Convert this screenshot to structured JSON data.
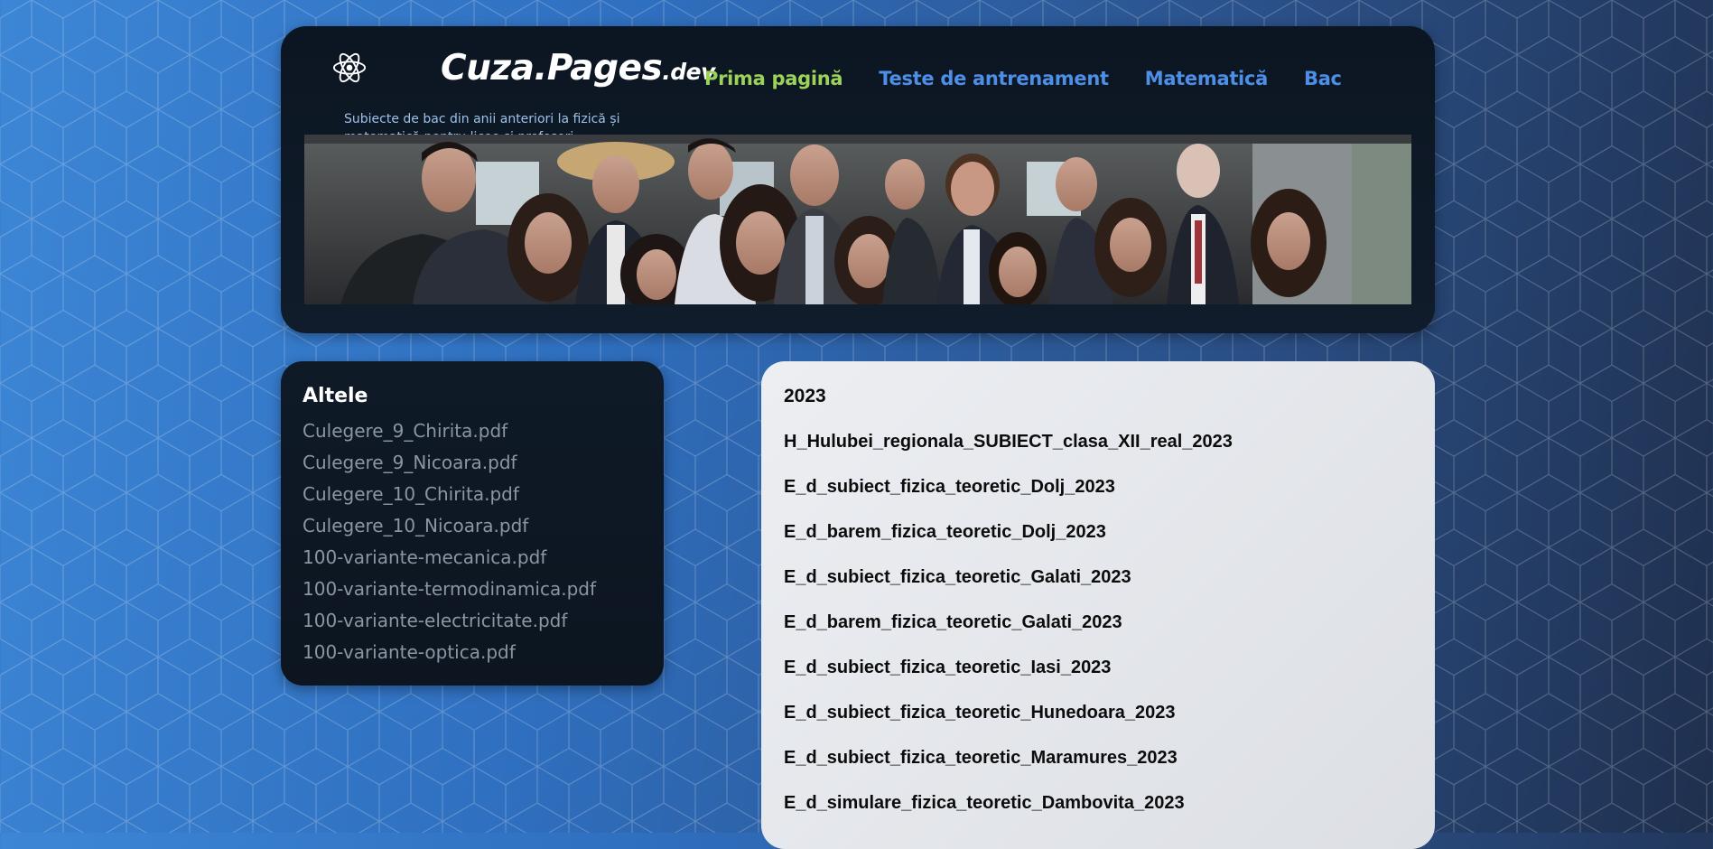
{
  "brand": {
    "name": "Cuza.Pages",
    "suffix": ".dev",
    "tagline": "Subiecte de bac din anii anteriori la fizică și matematică pentru licee și profesori."
  },
  "nav": [
    {
      "label": "Prima pagină",
      "active": true
    },
    {
      "label": "Teste de antrenament",
      "active": false
    },
    {
      "label": "Matematică",
      "active": false
    },
    {
      "label": "Bac",
      "active": false
    }
  ],
  "sidebar": {
    "title": "Altele",
    "items": [
      "Culegere_9_Chirita.pdf",
      "Culegere_9_Nicoara.pdf",
      "Culegere_10_Chirita.pdf",
      "Culegere_10_Nicoara.pdf",
      "100-variante-mecanica.pdf",
      "100-variante-termodinamica.pdf",
      "100-variante-electricitate.pdf",
      "100-variante-optica.pdf"
    ]
  },
  "main": {
    "year": "2023",
    "files": [
      "H_Hulubei_regionala_SUBIECT_clasa_XII_real_2023",
      "E_d_subiect_fizica_teoretic_Dolj_2023",
      "E_d_barem_fizica_teoretic_Dolj_2023",
      "E_d_subiect_fizica_teoretic_Galati_2023",
      "E_d_barem_fizica_teoretic_Galati_2023",
      "E_d_subiect_fizica_teoretic_Iasi_2023",
      "E_d_subiect_fizica_teoretic_Hunedoara_2023",
      "E_d_subiect_fizica_teoretic_Maramures_2023",
      "E_d_simulare_fizica_teoretic_Dambovita_2023"
    ]
  },
  "colors": {
    "nav_active": "#9bd35a",
    "nav_link": "#4d8fe6",
    "card_dark": "#0f1a27",
    "panel_light": "#e4e6ea",
    "sidebar_link": "#8c96a3"
  },
  "icons": {
    "logo": "atom-icon"
  }
}
